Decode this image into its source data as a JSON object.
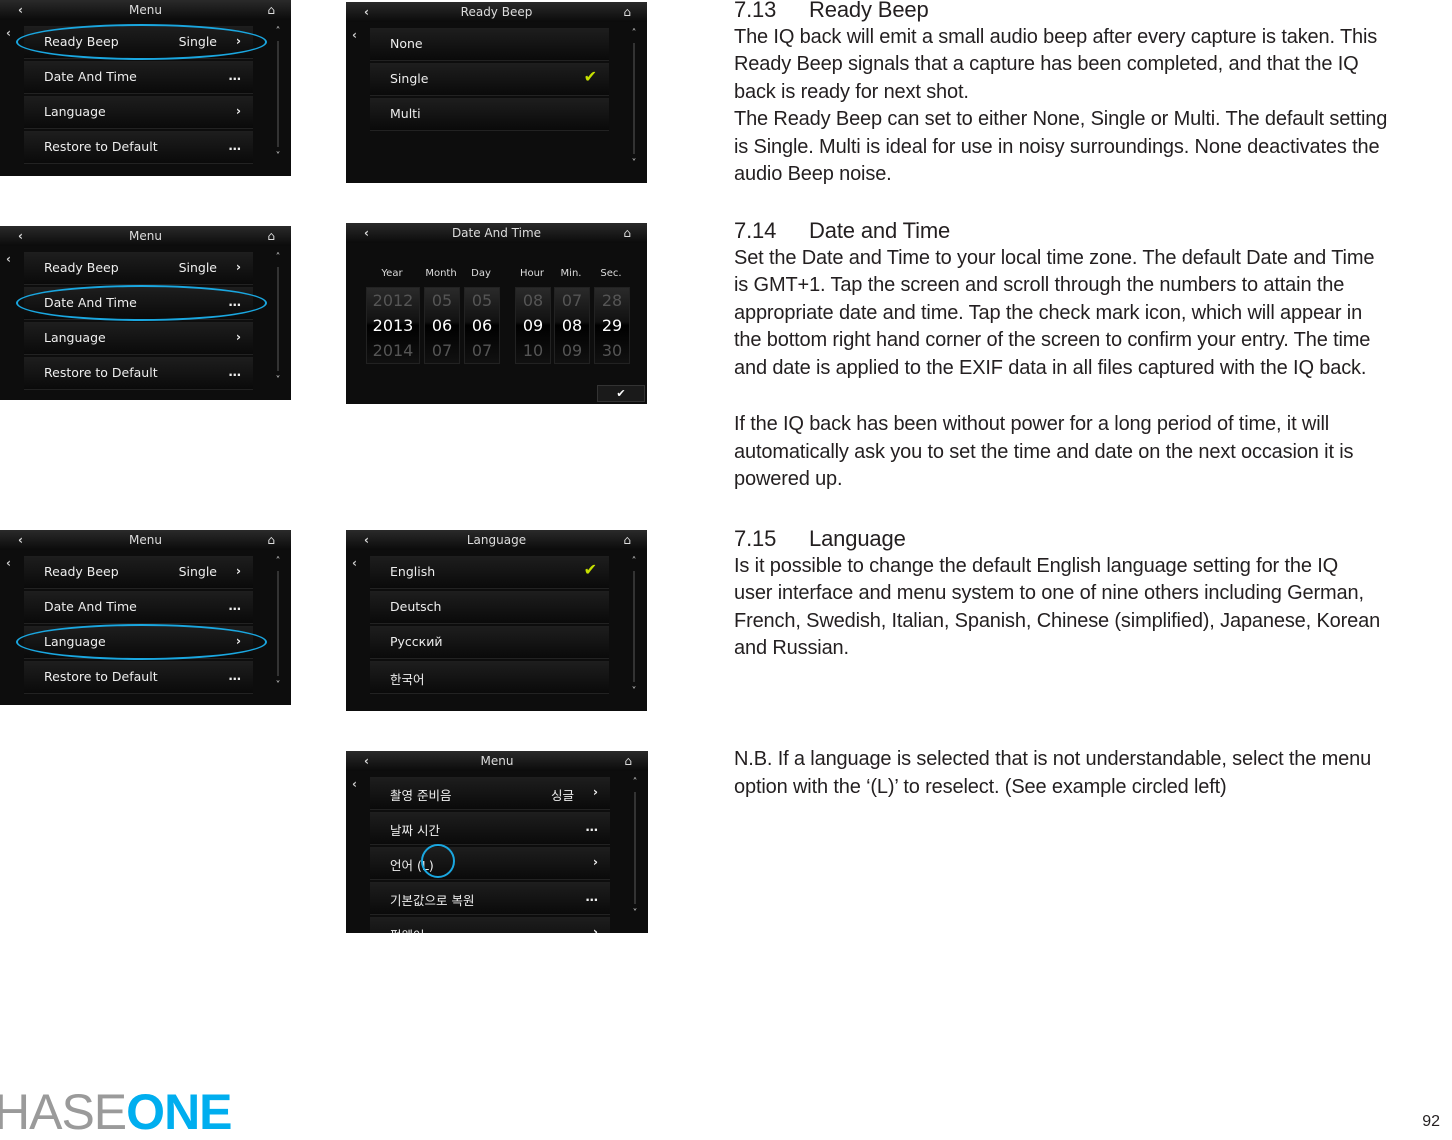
{
  "colors": {
    "accent": "#1aa7e0",
    "check": "#c6e000",
    "brand": "#00aeef"
  },
  "screens": [
    {
      "id": "menu-ready-beep",
      "title": "Menu",
      "scroll": true,
      "highlight": 0,
      "rows": [
        {
          "label": "Ready Beep",
          "value": "Single",
          "trail": "chevron"
        },
        {
          "label": "Date And Time",
          "trail": "dots"
        },
        {
          "label": "Language",
          "trail": "chevron"
        },
        {
          "label": "Restore to Default",
          "trail": "dots"
        }
      ]
    },
    {
      "id": "ready-beep",
      "title": "Ready Beep",
      "scroll": true,
      "rows": [
        {
          "label": "None"
        },
        {
          "label": "Single",
          "trail": "check"
        },
        {
          "label": "Multi"
        }
      ]
    },
    {
      "id": "menu-date-time",
      "title": "Menu",
      "scroll": true,
      "highlight": 1,
      "rows": [
        {
          "label": "Ready Beep",
          "value": "Single",
          "trail": "chevron"
        },
        {
          "label": "Date And Time",
          "trail": "dots"
        },
        {
          "label": "Language",
          "trail": "chevron"
        },
        {
          "label": "Restore to Default",
          "trail": "dots"
        }
      ]
    },
    {
      "id": "menu-language",
      "title": "Menu",
      "scroll": true,
      "highlight": 2,
      "rows": [
        {
          "label": "Ready Beep",
          "value": "Single",
          "trail": "chevron"
        },
        {
          "label": "Date And Time",
          "trail": "dots"
        },
        {
          "label": "Language",
          "trail": "chevron"
        },
        {
          "label": "Restore to Default",
          "trail": "dots"
        }
      ]
    },
    {
      "id": "language",
      "title": "Language",
      "scroll": true,
      "rows": [
        {
          "label": "English",
          "trail": "check"
        },
        {
          "label": "Deutsch"
        },
        {
          "label": "Русский"
        },
        {
          "label": "한국어"
        }
      ]
    },
    {
      "id": "menu-korean",
      "title": "Menu",
      "scroll": true,
      "circleL": true,
      "rows": [
        {
          "label": "촬영 준비음",
          "value": "싱글",
          "trail": "chevron"
        },
        {
          "label": "날짜 시간",
          "trail": "dots"
        },
        {
          "label": "언어 (L)",
          "trail": "chevron"
        },
        {
          "label": "기본값으로 복원",
          "trail": "dots"
        },
        {
          "label": "펌웨어",
          "trail": "chevron"
        }
      ]
    }
  ],
  "date_time": {
    "title": "Date And Time",
    "columns": [
      {
        "head": "Year",
        "values": [
          "2012",
          "2013",
          "2014"
        ]
      },
      {
        "head": "Month",
        "values": [
          "05",
          "06",
          "07"
        ]
      },
      {
        "head": "Day",
        "values": [
          "05",
          "06",
          "07"
        ]
      },
      {
        "head": "Hour",
        "values": [
          "08",
          "09",
          "10"
        ]
      },
      {
        "head": "Min.",
        "values": [
          "07",
          "08",
          "09"
        ]
      },
      {
        "head": "Sec.",
        "values": [
          "28",
          "29",
          "30"
        ]
      }
    ]
  },
  "text": {
    "s713": {
      "num": "7.13",
      "title": "Ready Beep",
      "lines": [
        "The IQ back will emit a small audio beep after every capture is taken. This",
        "Ready Beep signals that a capture has been completed, and that the IQ",
        "back is ready for next shot.",
        "The Ready Beep can set to either None, Single or Multi. The default setting",
        "is Single.  Multi is ideal for use in noisy surroundings. None deactivates the",
        "audio Beep noise."
      ]
    },
    "s714": {
      "num": "7.14",
      "title": "Date and Time",
      "lines": [
        "Set the Date and Time to your local time zone. The default Date and Time",
        "is GMT+1. Tap the screen and scroll through the numbers to attain the",
        "appropriate date and time. Tap the check mark icon, which will appear in",
        "the bottom right hand corner of the screen to confirm your entry. The time",
        "and date is applied to the EXIF data in all files captured with the IQ back."
      ]
    },
    "power": {
      "lines": [
        "If the IQ back has been without power for a long period of time, it will",
        "automatically ask you to set the time and date on the next occasion it is",
        "powered up."
      ]
    },
    "s715": {
      "num": "7.15",
      "title": "Language",
      "lines": [
        "Is it possible to change the default English language setting for the IQ",
        "user interface and menu system to one of nine others including German,",
        "French, Swedish, Italian, Spanish, Chinese (simplified), Japanese, Korean",
        "and Russian."
      ]
    },
    "nb": {
      "lines": [
        "N.B. If a language is selected that is not understandable, select the menu",
        "option with the ‘(L)’ to reselect. (See example circled left)"
      ]
    }
  },
  "footer": {
    "logo": "PHASEONE",
    "logo_light": "HASE",
    "logo_bold": "ONE",
    "page": "92"
  }
}
